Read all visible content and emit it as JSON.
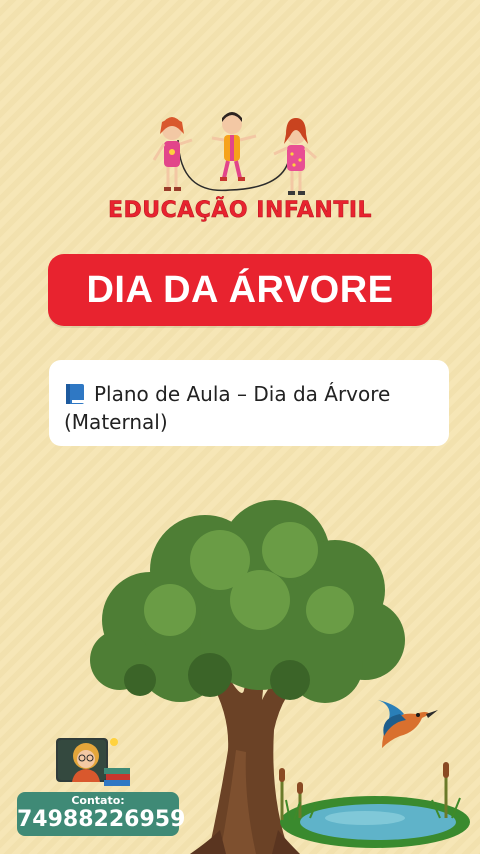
{
  "header": {
    "brand_title": "EDUCAÇÃO INFANTIL"
  },
  "banner": {
    "title": "DIA DA ÁRVORE"
  },
  "card": {
    "icon": "blue-book-icon",
    "text": "Plano de Aula – Dia da Árvore (Maternal)"
  },
  "contact": {
    "label": "Contato:",
    "phone": "74988226959"
  },
  "colors": {
    "background": "#f6e6b6",
    "accent_red": "#e8232f",
    "contact_green": "#3f8a76",
    "card_white": "#ffffff"
  },
  "illustrations": {
    "top": "children-jumping-rope-illustration",
    "main": "tree-illustration",
    "bird": "kingfisher-bird-illustration",
    "pond": "pond-illustration",
    "teacher": "teacher-avatar-illustration"
  }
}
